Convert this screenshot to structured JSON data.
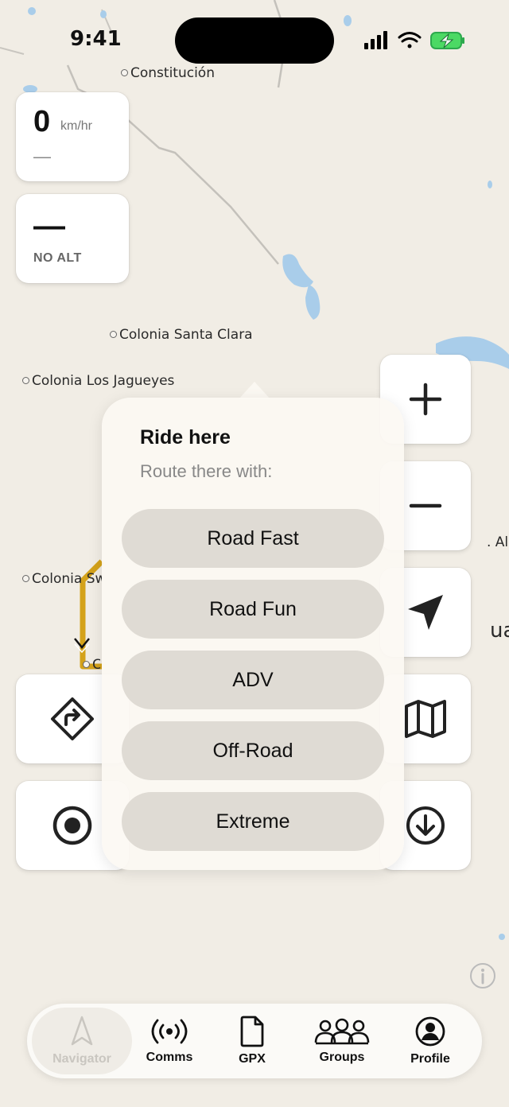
{
  "status_bar": {
    "time": "9:41"
  },
  "map": {
    "places": [
      {
        "name": "Constitución"
      },
      {
        "name": "Colonia Santa Clara"
      },
      {
        "name": "Colonia Los Jagueyes"
      },
      {
        "name": "Colonia Sw"
      },
      {
        "name": "C"
      },
      {
        "name": ". Alc"
      },
      {
        "name": "ua"
      }
    ],
    "route_color": "#d4a21a",
    "water_color": "#a9cdea"
  },
  "speed": {
    "value": "0",
    "unit": "km/hr",
    "secondary": "—"
  },
  "altitude": {
    "value": "—",
    "label": "NO ALT"
  },
  "controls": {
    "zoom_in": "plus-icon",
    "zoom_out": "minus-icon",
    "locate": "location-arrow-icon",
    "map_layers": "map-icon",
    "directions": "turn-right-diamond-icon",
    "record": "record-icon",
    "download": "download-icon"
  },
  "popup": {
    "title": "Ride here",
    "subtitle": "Route there with:",
    "options": [
      "Road Fast",
      "Road Fun",
      "ADV",
      "Off-Road",
      "Extreme"
    ]
  },
  "tabs": [
    {
      "label": "Navigator",
      "icon": "navigator-arrow-icon",
      "active": true
    },
    {
      "label": "Comms",
      "icon": "radio-waves-icon",
      "active": false
    },
    {
      "label": "GPX",
      "icon": "file-icon",
      "active": false
    },
    {
      "label": "Groups",
      "icon": "groups-icon",
      "active": false
    },
    {
      "label": "Profile",
      "icon": "profile-icon",
      "active": false
    }
  ]
}
